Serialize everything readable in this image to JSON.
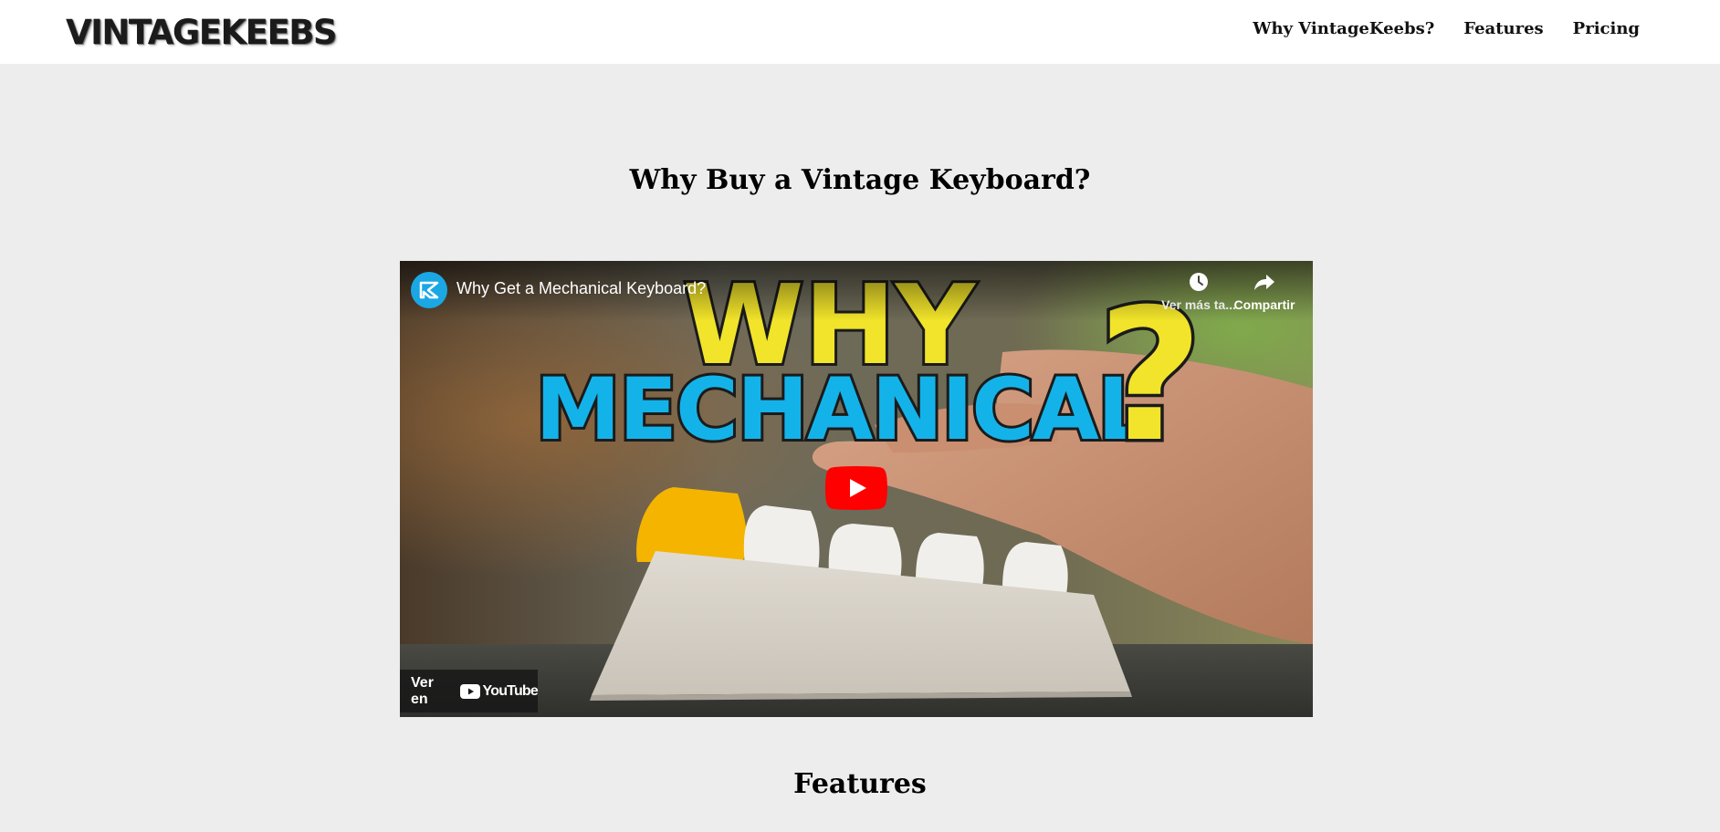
{
  "header": {
    "logo_text": "VINTAGEKEEBS",
    "nav": [
      {
        "label": "Why VintageKeebs?"
      },
      {
        "label": "Features"
      },
      {
        "label": "Pricing"
      }
    ]
  },
  "sections": {
    "why_title": "Why Buy a Vintage Keyboard?",
    "features_title": "Features"
  },
  "video": {
    "title": "Why Get a Mechanical Keyboard?",
    "watch_later_label": "Ver más ta...",
    "share_label": "Compartir",
    "watch_on_label": "Ver en",
    "youtube_brand": "YouTube",
    "thumbnail_text_top": "WHY",
    "thumbnail_text_main": "MECHANICAL",
    "thumbnail_text_qmark": "?",
    "channel_icon": "channel-logo-icon",
    "colors": {
      "thumb_yellow": "#f2e42a",
      "thumb_blue": "#13b3ea",
      "play_red": "#ff0000",
      "avatar_blue": "#1aa7e4"
    }
  }
}
